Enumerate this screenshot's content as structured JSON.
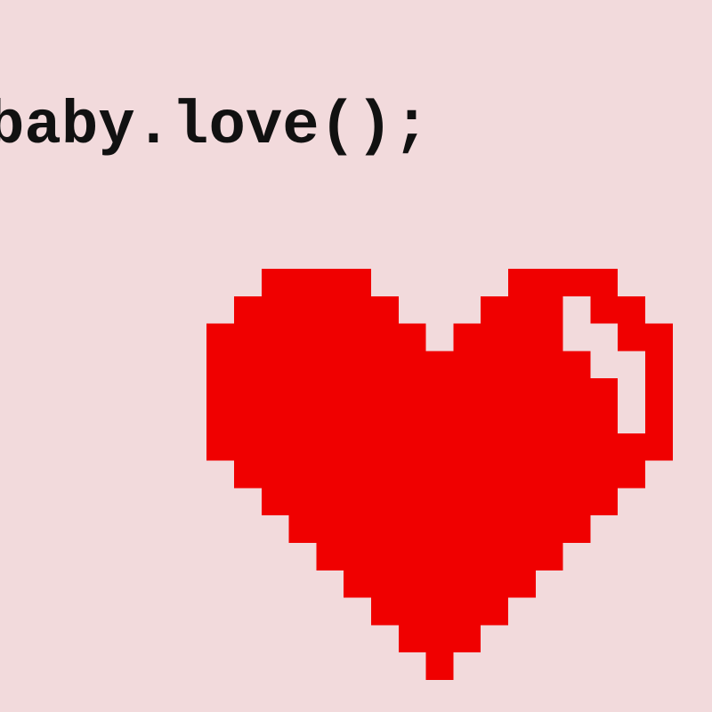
{
  "code_text": "baby.love();",
  "colors": {
    "background": "#f2dadc",
    "text": "#111111",
    "heart": "#f00000",
    "highlight": "#f2dadc"
  },
  "icon": "pixel-heart-icon"
}
